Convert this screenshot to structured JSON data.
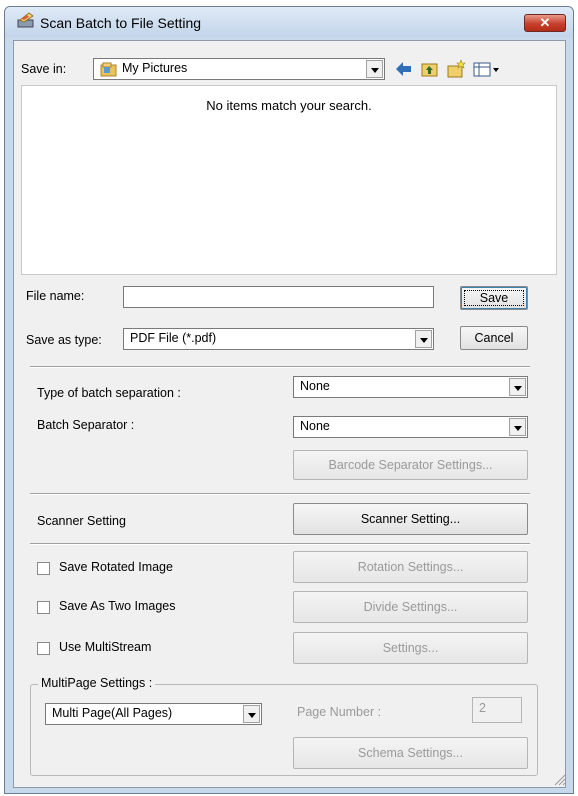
{
  "window": {
    "title": "Scan Batch to File Setting",
    "close_label": "✕"
  },
  "toolbar": {
    "save_in_label": "Save in:",
    "save_in_value": "My Pictures",
    "icons": [
      "back-arrow-icon",
      "up-folder-icon",
      "new-folder-icon",
      "view-menu-icon"
    ]
  },
  "file_list": {
    "empty_message": "No items match your search."
  },
  "file_name": {
    "label": "File name:",
    "value": ""
  },
  "save_as_type": {
    "label": "Save as type:",
    "value": "PDF File (*.pdf)"
  },
  "buttons": {
    "save": "Save",
    "cancel": "Cancel",
    "barcode_separator": "Barcode Separator Settings...",
    "scanner_setting": "Scanner Setting...",
    "rotation_settings": "Rotation Settings...",
    "divide_settings": "Divide Settings...",
    "settings": "Settings...",
    "schema_settings": "Schema Settings..."
  },
  "batch": {
    "type_label": "Type of batch separation :",
    "type_value": "None",
    "separator_label": "Batch Separator :",
    "separator_value": "None"
  },
  "scanner": {
    "label": "Scanner Setting"
  },
  "options": {
    "rotated": {
      "label": "Save Rotated Image",
      "checked": false
    },
    "two_images": {
      "label": "Save As Two Images",
      "checked": false
    },
    "multistream": {
      "label": "Use MultiStream",
      "checked": false
    }
  },
  "multipage": {
    "group_label": "MultiPage Settings :",
    "mode_value": "Multi Page(All Pages)",
    "page_number_label": "Page Number :",
    "page_number_value": "2"
  }
}
